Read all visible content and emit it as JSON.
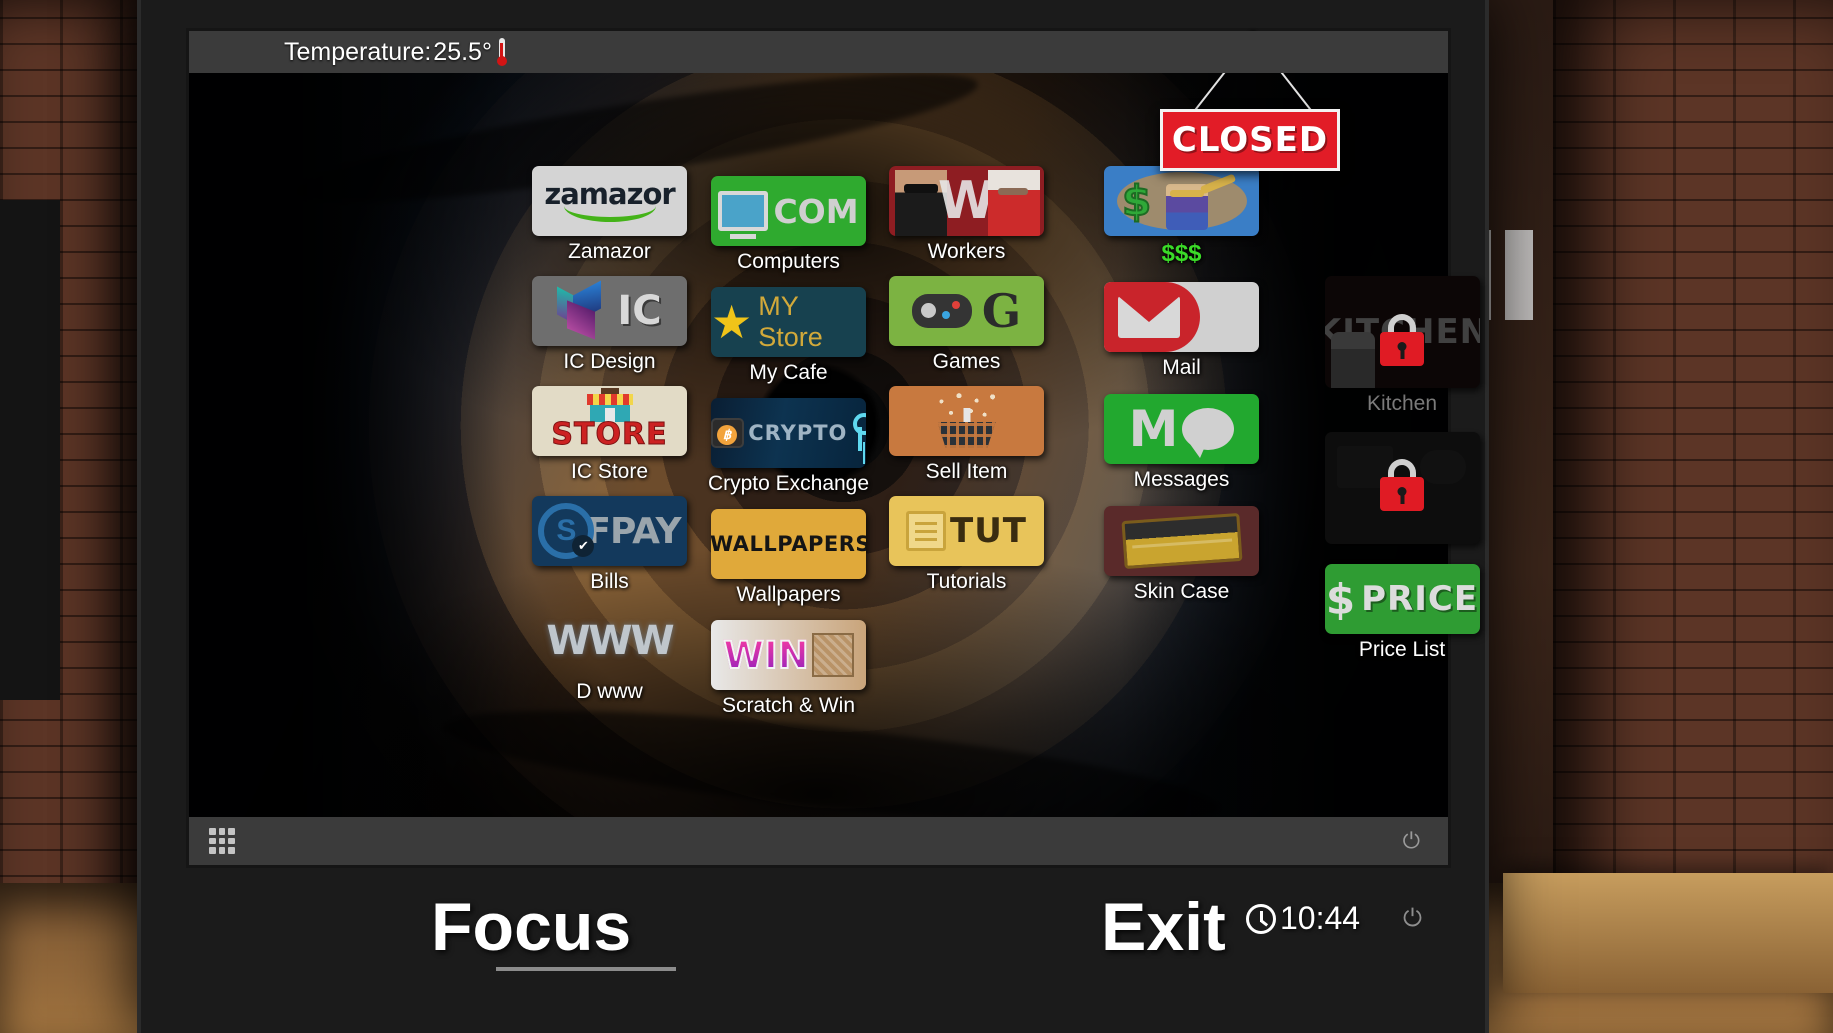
{
  "status_bar": {
    "temperature_label": "Temperature:",
    "temperature_value": "25.5°",
    "thermometer_icon": "thermometer-icon"
  },
  "sign": {
    "text": "CLOSED",
    "color": "#e21c27"
  },
  "columns": [
    {
      "id": "col1",
      "apps": [
        {
          "label": "Zamazor",
          "tile_text": "zamazor",
          "color": "#d4d4d4",
          "icon": "zamazor-logo-icon",
          "locked": false
        },
        {
          "label": "IC Design",
          "tile_text": "IC",
          "color": "#6e6e6e",
          "icon": "ic-design-prism-icon",
          "locked": false
        },
        {
          "label": "IC Store",
          "tile_text": "STORE",
          "color": "#e2dbc6",
          "icon": "storefront-icon",
          "locked": false
        },
        {
          "label": "Bills",
          "tile_text": "FPAY",
          "color": "#13395c",
          "icon": "fpay-logo-icon",
          "locked": false
        },
        {
          "label": "D www",
          "tile_text": "WWW",
          "color": "#000000",
          "icon": "www-icon",
          "locked": false
        }
      ]
    },
    {
      "id": "col2",
      "apps": [
        {
          "label": "Computers",
          "tile_text": "COM",
          "color": "#2faa2f",
          "icon": "desktop-computer-icon",
          "locked": false
        },
        {
          "label": "My Cafe",
          "tile_text": "MY Store",
          "color": "#17414f",
          "icon": "gold-star-icon",
          "locked": false
        },
        {
          "label": "Crypto Exchange",
          "tile_text": "CRYPTO",
          "color": "#0d3350",
          "icon": "bitcoin-wallet-key-icon",
          "locked": false
        },
        {
          "label": "Wallpapers",
          "tile_text": "WALLPAPERS",
          "color": "#e0a93a",
          "icon": "photo-landscape-icon",
          "locked": false
        },
        {
          "label": "Scratch & Win",
          "tile_text": "WIN",
          "color": "#c9a47a",
          "icon": "scratch-card-icon",
          "locked": false
        }
      ]
    },
    {
      "id": "col3",
      "apps": [
        {
          "label": "Workers",
          "tile_text": "W",
          "color": "#8e1d22",
          "icon": "worker-characters-icon",
          "locked": false
        },
        {
          "label": "Games",
          "tile_text": "G",
          "color": "#7cb342",
          "icon": "gamepad-icon",
          "locked": false
        },
        {
          "label": "Sell Item",
          "tile_text": "",
          "color": "#c8793f",
          "icon": "shopping-basket-icon",
          "locked": false
        },
        {
          "label": "Tutorials",
          "tile_text": "TUT",
          "color": "#e8c45a",
          "icon": "folder-icon",
          "locked": false
        }
      ]
    },
    {
      "id": "col4",
      "apps": [
        {
          "label": "$$$",
          "tile_text": "",
          "color": "#3a7ec6",
          "icon": "money-bag-icon",
          "locked": false,
          "label_style": "green"
        },
        {
          "label": "Mail",
          "tile_text": "",
          "color": "#c9242b",
          "icon": "envelope-icon",
          "locked": false
        },
        {
          "label": "Messages",
          "tile_text": "M",
          "color": "#22a82f",
          "icon": "speech-bubble-icon",
          "locked": false
        },
        {
          "label": "Skin Case",
          "tile_text": "",
          "color": "#5a2a2a",
          "icon": "briefcase-case-icon",
          "locked": false
        }
      ]
    },
    {
      "id": "col5",
      "apps": [
        {
          "label": "Kitchen",
          "tile_text": "KITCHEN",
          "color": "#3a1010",
          "icon": "kitchen-icon",
          "locked": true
        },
        {
          "label": "",
          "tile_text": "",
          "color": "#2a2a2a",
          "icon": "locked-app-icon",
          "locked": true
        },
        {
          "label": "Price List",
          "tile_text": "PRICE",
          "color": "#2f9c33",
          "icon": "dollar-price-icon",
          "locked": false
        }
      ]
    }
  ],
  "taskbar": {
    "apps_grid_icon": "apps-grid-icon",
    "power_icon": "power-icon"
  },
  "overlay": {
    "focus_label": "Focus",
    "exit_label": "Exit",
    "clock_icon": "clock-icon",
    "clock_time": "10:44",
    "power_glyph": "⏻"
  }
}
